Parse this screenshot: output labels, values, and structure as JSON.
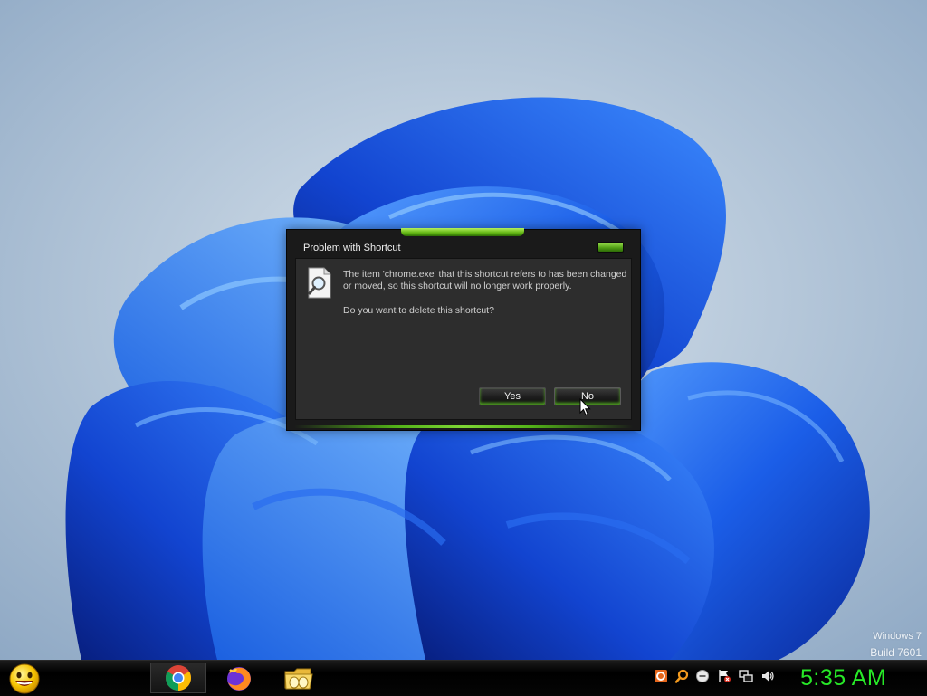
{
  "desktop": {
    "watermark_line1": "Windows 7",
    "watermark_line2": "Build 7601"
  },
  "dialog": {
    "title": "Problem with Shortcut",
    "message": "The item 'chrome.exe' that this shortcut refers to has been changed or moved, so this shortcut will no longer work properly.",
    "question": "Do you want to delete this shortcut?",
    "yes_label": "Yes",
    "no_label": "No",
    "icon": "document-magnifier-icon",
    "accent_color": "#5fb312"
  },
  "taskbar": {
    "start_icon": "smiley-start-icon",
    "items": [
      {
        "name": "Google Chrome",
        "icon": "chrome-icon",
        "active": true
      },
      {
        "name": "Firefox",
        "icon": "firefox-icon",
        "active": false
      },
      {
        "name": "Explorer",
        "icon": "folder-icon",
        "active": false
      }
    ],
    "tray_icons": [
      "avast-icon",
      "search-icon",
      "messenger-icon",
      "action-center-flag-icon",
      "network-icon",
      "volume-icon"
    ],
    "clock": "5:35 AM",
    "clock_color": "#27e827"
  }
}
